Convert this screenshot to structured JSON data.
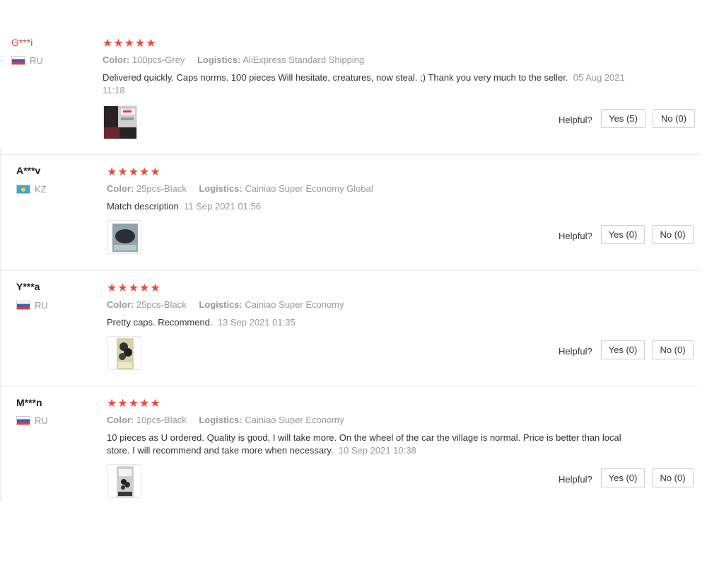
{
  "reviews": [
    {
      "user": "G***i",
      "country": "RU",
      "stars": "★★★★★",
      "color_label": "Color:",
      "color_value": "100pcs-Grey",
      "logistics_label": "Logistics:",
      "logistics_value": "AliExpress Standard Shipping",
      "text": "Delivered quickly. Caps norms. 100 pieces Will hesitate, creatures, now steal. ;) Thank you very much to the seller.",
      "date": "05 Aug 2021 11:18",
      "helpful_label": "Helpful?",
      "yes_label": "Yes (5)",
      "no_label": "No (0)"
    },
    {
      "user": "A***v",
      "country": "KZ",
      "stars": "★★★★★",
      "color_label": "Color:",
      "color_value": "25pcs-Black",
      "logistics_label": "Logistics:",
      "logistics_value": "Cainiao Super Economy Global",
      "text": "Match description",
      "date": "11 Sep 2021 01:56",
      "helpful_label": "Helpful?",
      "yes_label": "Yes (0)",
      "no_label": "No (0)"
    },
    {
      "user": "Y***a",
      "country": "RU",
      "stars": "★★★★★",
      "color_label": "Color:",
      "color_value": "25pcs-Black",
      "logistics_label": "Logistics:",
      "logistics_value": "Cainiao Super Economy",
      "text": "Pretty caps. Recommend.",
      "date": "13 Sep 2021 01:35",
      "helpful_label": "Helpful?",
      "yes_label": "Yes (0)",
      "no_label": "No (0)"
    },
    {
      "user": "M***n",
      "country": "RU",
      "stars": "★★★★★",
      "color_label": "Color:",
      "color_value": "10pcs-Black",
      "logistics_label": "Logistics:",
      "logistics_value": "Cainiao Super Economy",
      "text": "10 pieces as U ordered. Quality is good, I will take more. On the wheel of the car the village is normal. Price is better than local store. I will recommend and take more when necessary.",
      "date": "10 Sep 2021 10:38",
      "helpful_label": "Helpful?",
      "yes_label": "Yes (0)",
      "no_label": "No (0)"
    }
  ],
  "colors": {
    "star": "#ee4a3d",
    "highlight_user": "#e83a3a",
    "muted": "#999999",
    "border": "#e8e8e8"
  }
}
